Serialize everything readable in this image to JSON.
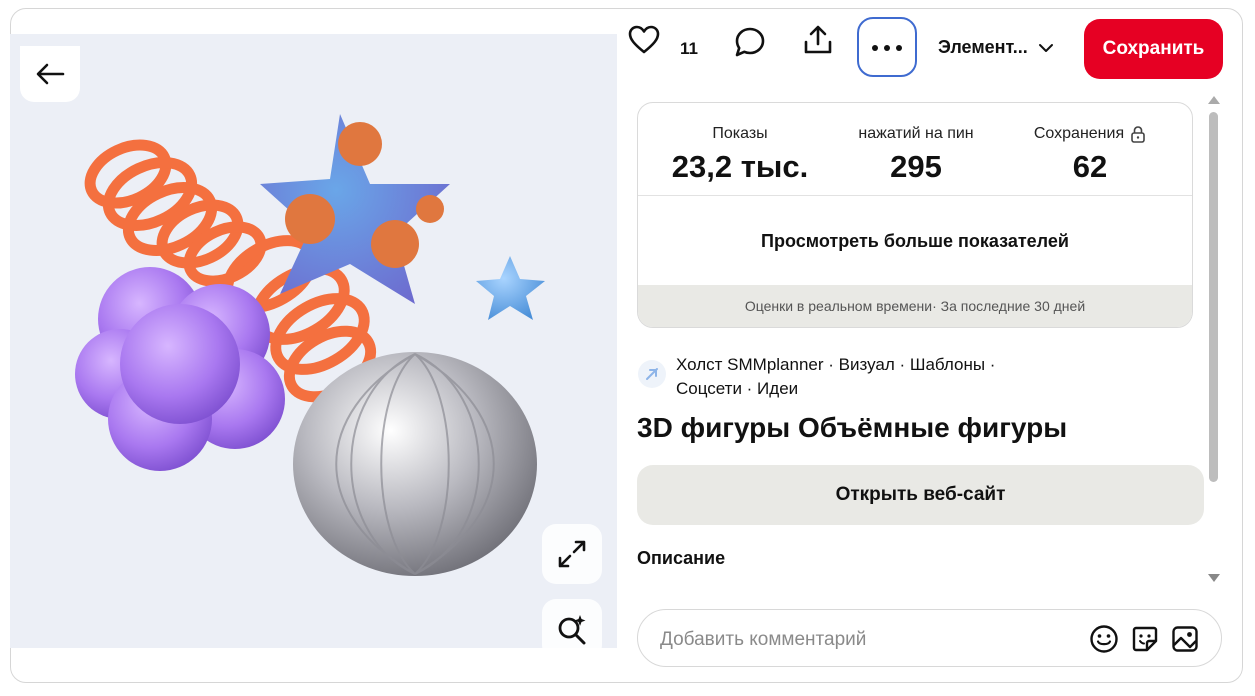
{
  "toolbar": {
    "likes_count": "11",
    "board_name": "Элемент...",
    "save_label": "Сохранить"
  },
  "stats": {
    "items": [
      {
        "label": "Показы",
        "value": "23,2 тыс."
      },
      {
        "label": "нажатий на пин",
        "value": "295"
      },
      {
        "label": "Сохранения",
        "value": "62"
      }
    ],
    "more_label": "Просмотреть больше показателей",
    "footer": "Оценки в реальном времени· За последние 30 дней"
  },
  "pin": {
    "source_line1": "Холст SMMplanner · Визуал · Шаблоны ·",
    "source_line2": "Соцсети · Идеи",
    "title": "3D фигуры Объёмные фигуры",
    "open_site_label": "Открыть веб-сайт",
    "description_title": "Описание"
  },
  "comment": {
    "placeholder": "Добавить комментарий"
  },
  "colors": {
    "accent": "#e60023",
    "focus_ring": "#3f6bd0",
    "media_bg": "#eceff6"
  },
  "icons": [
    "back-arrow-icon",
    "heart-icon",
    "comment-icon",
    "share-icon",
    "more-icon",
    "chevron-down-icon",
    "lock-icon",
    "expand-icon",
    "visual-search-icon",
    "emoji-icon",
    "sticker-icon",
    "image-icon"
  ]
}
